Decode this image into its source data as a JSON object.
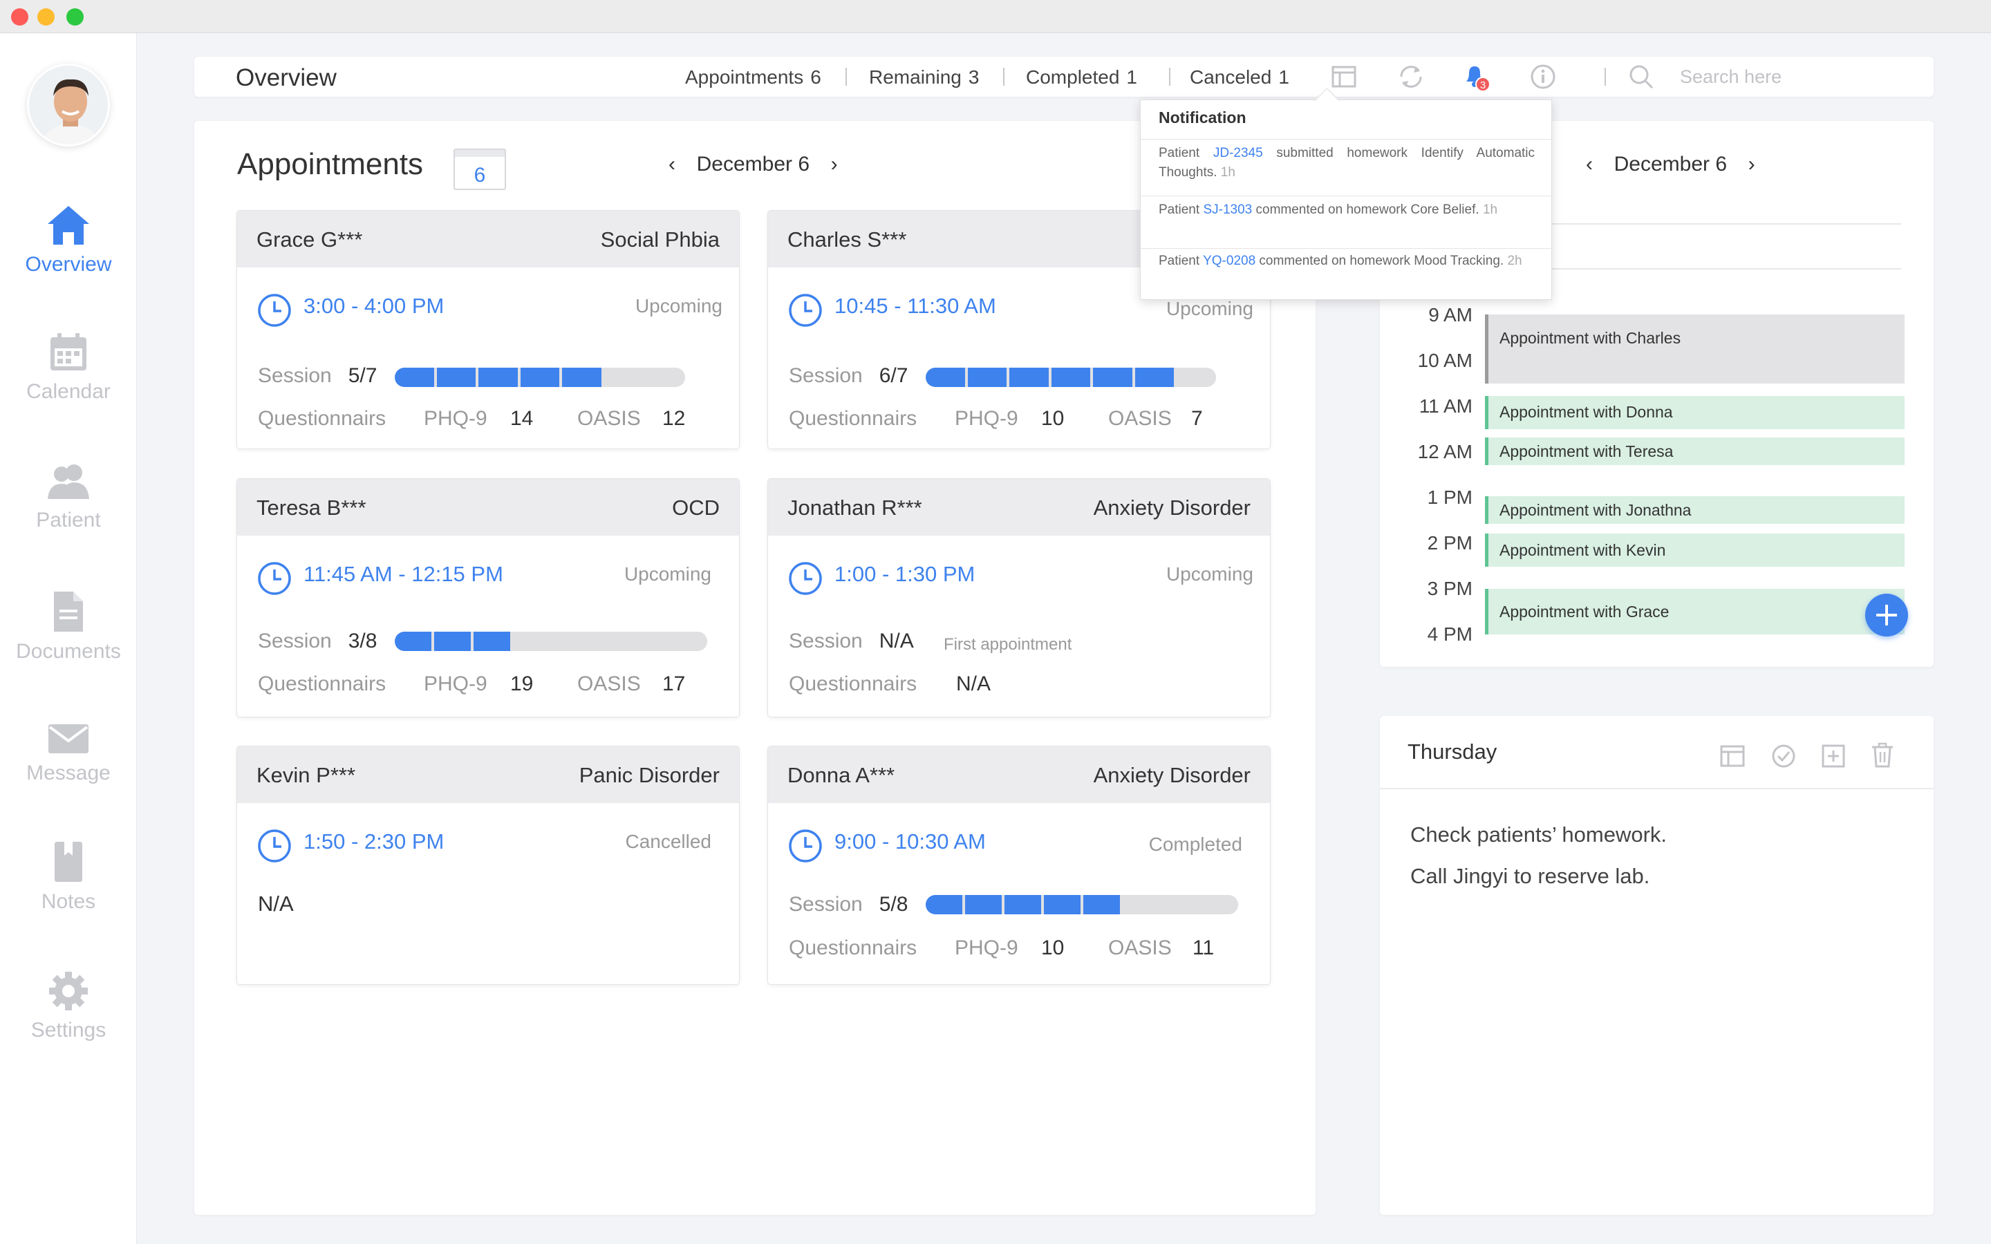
{
  "window": {
    "dots": [
      "#fd5b58",
      "#fdbb2e",
      "#2bc840"
    ]
  },
  "sidebar": {
    "items": [
      {
        "label": "Overview",
        "icon": "home-icon",
        "active": true
      },
      {
        "label": "Calendar",
        "icon": "calendar-icon"
      },
      {
        "label": "Patient",
        "icon": "people-icon"
      },
      {
        "label": "Documents",
        "icon": "document-icon"
      },
      {
        "label": "Message",
        "icon": "mail-icon"
      },
      {
        "label": "Notes",
        "icon": "bookmark-icon"
      },
      {
        "label": "Settings",
        "icon": "gear-icon"
      }
    ]
  },
  "header": {
    "title": "Overview",
    "stats": [
      {
        "label": "Appointments",
        "value": "6"
      },
      {
        "label": "Remaining",
        "value": "3"
      },
      {
        "label": "Completed",
        "value": "1"
      },
      {
        "label": "Canceled",
        "value": "1"
      }
    ],
    "notification_badge": "3",
    "search_placeholder": "Search here"
  },
  "appointments": {
    "title": "Appointments",
    "count": "6",
    "date": "December 6",
    "cards": [
      {
        "name": "Grace G***",
        "diagnosis": "Social Phbia",
        "time": "3:00 - 4:00 PM",
        "status": "Upcoming",
        "session_label": "Session",
        "session": "5/7",
        "session_done": 5,
        "session_total": 7,
        "q_label": "Questionnairs",
        "phq_label": "PHQ-9",
        "phq": "14",
        "oasis_label": "OASIS",
        "oasis": "12"
      },
      {
        "name": "Charles S***",
        "diagnosis": "",
        "time": "10:45 - 11:30 AM",
        "status": "Upcoming",
        "session_label": "Session",
        "session": "6/7",
        "session_done": 6,
        "session_total": 7,
        "q_label": "Questionnairs",
        "phq_label": "PHQ-9",
        "phq": "10",
        "oasis_label": "OASIS",
        "oasis": "7"
      },
      {
        "name": "Teresa B***",
        "diagnosis": "OCD",
        "time": "11:45 AM - 12:15 PM",
        "status": "Upcoming",
        "session_label": "Session",
        "session": "3/8",
        "session_done": 3,
        "session_total": 8,
        "q_label": "Questionnairs",
        "phq_label": "PHQ-9",
        "phq": "19",
        "oasis_label": "OASIS",
        "oasis": "17"
      },
      {
        "name": "Jonathan R***",
        "diagnosis": "Anxiety Disorder",
        "time": "1:00 - 1:30 PM",
        "status": "Upcoming",
        "session_label": "Session",
        "session": "N/A",
        "first_note": "First appointment",
        "q_label": "Questionnairs",
        "q_value": "N/A"
      },
      {
        "name": "Kevin P***",
        "diagnosis": "Panic Disorder",
        "time": "1:50  - 2:30 PM",
        "status": "Cancelled",
        "na": "N/A"
      },
      {
        "name": "Donna A***",
        "diagnosis": "Anxiety Disorder",
        "time": "9:00 - 10:30 AM",
        "status": "Completed",
        "session_label": "Session",
        "session": "5/8",
        "session_done": 5,
        "session_total": 8,
        "q_label": "Questionnairs",
        "phq_label": "PHQ-9",
        "phq": "10",
        "oasis_label": "OASIS",
        "oasis": "11"
      }
    ]
  },
  "notifications": {
    "title": "Notification",
    "items": [
      {
        "prefix": "Patient",
        "patient_id": "JD-2345",
        "text": "submitted homework Identify Automatic Thoughts.",
        "ago": "1h"
      },
      {
        "prefix": "Patient",
        "patient_id": "SJ-1303",
        "text": "commented on homework Core Belief.",
        "ago": "1h"
      },
      {
        "prefix": "Patient",
        "patient_id": "YQ-0208",
        "text": "commented on homework Mood Tracking.",
        "ago": "2h"
      }
    ]
  },
  "schedule": {
    "date": "December 6",
    "hours": [
      "9 AM",
      "10 AM",
      "11 AM",
      "12 AM",
      "1 PM",
      "2 PM",
      "3 PM",
      "4 PM"
    ],
    "events": [
      {
        "label": "Appointment with Charles",
        "type": "gray"
      },
      {
        "label": "Appointment with Donna",
        "type": "green"
      },
      {
        "label": "Appointment with Teresa",
        "type": "green"
      },
      {
        "label": "Appointment with Jonathna",
        "type": "green"
      },
      {
        "label": "Appointment with Kevin",
        "type": "green"
      },
      {
        "label": "Appointment with Grace",
        "type": "green"
      }
    ]
  },
  "notes": {
    "day": "Thursday",
    "items": [
      "Check patients’ homework.",
      "Call Jingyi to reserve lab."
    ]
  },
  "colors": {
    "accent": "#3e82ee",
    "event_green": "#d9f0e3",
    "event_border": "#5ec493",
    "progress_empty": "#e0e0e2"
  }
}
